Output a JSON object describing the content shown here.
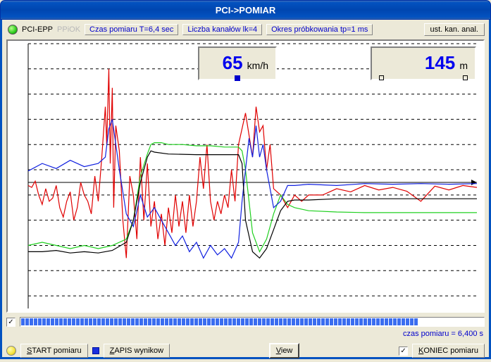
{
  "title": "PCI->POMIAR",
  "status": {
    "mode_active": "PCI-EPP",
    "mode_inactive": "PPiOK",
    "czas_pomiaru": "Czas pomiaru T=6,4 sec",
    "liczba_kanalow": "Liczba kanałów lk=4",
    "okres_probkowania": "Okres próbkowania tp=1 ms",
    "ust_button": "ust. kan. anal."
  },
  "readouts": {
    "r1": {
      "value": "65",
      "unit": "km/h"
    },
    "r2": {
      "value": "145",
      "unit": "m"
    }
  },
  "progress": {
    "checked": "✓",
    "time_label": "czas pomiaru = 6,400 s"
  },
  "bottom": {
    "start_u": "S",
    "start_rest": "TART pomiaru",
    "zapis_u": "Z",
    "zapis_rest": "APIS wynikow",
    "view_u": "V",
    "view_rest": "iew",
    "koniec_u": "K",
    "koniec_rest": "ONIEC pomiaru",
    "koniec_checked": "✓"
  },
  "chart_data": {
    "type": "line",
    "xlabel": "",
    "ylabel": "",
    "xrange": [
      0,
      6.4
    ],
    "yrange": [
      -200,
      220
    ],
    "gridlines_y": [
      -180,
      -140,
      -100,
      -60,
      -20,
      20,
      60,
      100,
      140,
      180,
      220
    ],
    "axis_y_zero": 0,
    "series": [
      {
        "name": "kanal-czerwony",
        "color": "#e00000",
        "x": [
          0.0,
          0.05,
          0.1,
          0.15,
          0.2,
          0.25,
          0.3,
          0.35,
          0.4,
          0.45,
          0.5,
          0.55,
          0.6,
          0.65,
          0.7,
          0.75,
          0.8,
          0.85,
          0.9,
          0.95,
          1.0,
          1.05,
          1.1,
          1.12,
          1.15,
          1.17,
          1.2,
          1.22,
          1.25,
          1.3,
          1.35,
          1.4,
          1.45,
          1.5,
          1.55,
          1.6,
          1.65,
          1.7,
          1.75,
          1.8,
          1.85,
          1.9,
          1.95,
          2.0,
          2.05,
          2.1,
          2.15,
          2.2,
          2.25,
          2.3,
          2.35,
          2.4,
          2.45,
          2.5,
          2.55,
          2.6,
          2.65,
          2.7,
          2.75,
          2.8,
          2.85,
          2.9,
          2.95,
          3.0,
          3.1,
          3.2,
          3.25,
          3.3,
          3.35,
          3.4,
          3.45,
          3.5,
          3.6,
          3.7,
          3.8,
          3.9,
          4.0,
          4.2,
          4.4,
          4.6,
          4.8,
          5.0,
          5.2,
          5.4,
          5.6,
          5.8,
          6.0,
          6.2,
          6.4
        ],
        "y": [
          -5,
          -8,
          2,
          -20,
          -35,
          -10,
          -30,
          -25,
          -5,
          -40,
          -55,
          -30,
          -15,
          -60,
          -40,
          0,
          -20,
          -30,
          -50,
          10,
          -30,
          40,
          120,
          60,
          180,
          30,
          150,
          -40,
          90,
          50,
          -60,
          -120,
          10,
          -20,
          -90,
          40,
          -60,
          30,
          -70,
          -30,
          -90,
          -50,
          -100,
          -40,
          -80,
          -20,
          -70,
          -30,
          -80,
          -20,
          -70,
          -30,
          40,
          -10,
          60,
          -30,
          -60,
          -30,
          -50,
          -20,
          -40,
          20,
          -30,
          60,
          110,
          40,
          120,
          80,
          90,
          20,
          60,
          -10,
          -20,
          -40,
          -20,
          -30,
          -20,
          -20,
          -10,
          -15,
          -5,
          -12,
          -8,
          -14,
          -30,
          -6,
          -12,
          -5,
          -8
        ]
      },
      {
        "name": "kanal-zielony",
        "color": "#20d020",
        "x": [
          0.0,
          0.2,
          0.4,
          0.6,
          0.8,
          1.0,
          1.2,
          1.4,
          1.5,
          1.6,
          1.7,
          1.75,
          1.8,
          1.9,
          2.0,
          2.2,
          2.4,
          2.6,
          2.8,
          3.0,
          3.05,
          3.1,
          3.2,
          3.3,
          3.4,
          3.5,
          3.6,
          3.7,
          3.8,
          4.0,
          4.4,
          4.8,
          5.2,
          5.6,
          6.0,
          6.4
        ],
        "y": [
          -100,
          -95,
          -100,
          -105,
          -100,
          -105,
          -100,
          -90,
          -60,
          10,
          45,
          60,
          63,
          63,
          60,
          60,
          58,
          58,
          56,
          56,
          50,
          20,
          -80,
          -110,
          -90,
          -50,
          -20,
          -35,
          -40,
          -45,
          -47,
          -48,
          -48,
          -48,
          -48,
          -48
        ]
      },
      {
        "name": "kanal-niebieski",
        "color": "#1020e0",
        "x": [
          0.0,
          0.2,
          0.4,
          0.6,
          0.8,
          1.0,
          1.1,
          1.15,
          1.2,
          1.25,
          1.3,
          1.4,
          1.5,
          1.6,
          1.7,
          1.8,
          1.9,
          2.0,
          2.1,
          2.2,
          2.3,
          2.4,
          2.5,
          2.6,
          2.7,
          2.8,
          2.9,
          3.0,
          3.05,
          3.1,
          3.15,
          3.2,
          3.25,
          3.3,
          3.35,
          3.4,
          3.5,
          3.6,
          3.7,
          3.8,
          4.0,
          4.4,
          4.8,
          5.2,
          5.6,
          6.0,
          6.4
        ],
        "y": [
          18,
          30,
          22,
          35,
          25,
          30,
          40,
          85,
          100,
          60,
          20,
          -50,
          -70,
          -20,
          -55,
          -40,
          -60,
          -80,
          -100,
          -85,
          -110,
          -95,
          -120,
          -100,
          -115,
          -105,
          -120,
          -95,
          -30,
          20,
          70,
          40,
          90,
          40,
          60,
          20,
          -40,
          -30,
          -5,
          -5,
          -3,
          -5,
          -2,
          -3,
          -2,
          -3,
          -2
        ]
      },
      {
        "name": "kanal-czarny",
        "color": "#000000",
        "x": [
          0.0,
          0.2,
          0.4,
          0.6,
          0.8,
          1.0,
          1.2,
          1.4,
          1.5,
          1.6,
          1.7,
          1.75,
          1.8,
          2.0,
          2.4,
          2.8,
          3.0,
          3.05,
          3.1,
          3.2,
          3.3,
          3.4,
          3.5,
          3.6,
          3.7,
          3.8,
          4.0,
          4.4,
          4.8,
          5.2,
          5.6,
          6.0,
          6.4
        ],
        "y": [
          -110,
          -110,
          -108,
          -112,
          -110,
          -112,
          -108,
          -95,
          -60,
          0,
          40,
          50,
          48,
          45,
          44,
          44,
          44,
          30,
          -60,
          -110,
          -120,
          -105,
          -75,
          -45,
          -30,
          -28,
          -28,
          -26,
          -26,
          -26,
          -26,
          -26,
          -26
        ]
      }
    ]
  }
}
